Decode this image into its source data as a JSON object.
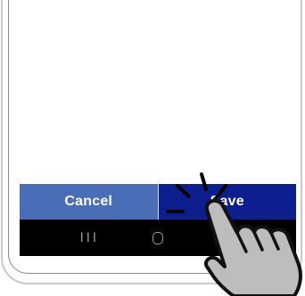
{
  "actions": {
    "cancel_label": "Cancel",
    "save_label": "Save"
  },
  "nav": {
    "recents_icon": "recents-icon",
    "home_icon": "home-icon",
    "back_icon": "back-icon",
    "recents_glyph": "III"
  },
  "overlay": {
    "gesture_icon": "tap-hand-icon"
  },
  "colors": {
    "cancel_bg": "#4a6db8",
    "save_bg": "#0d1f8f",
    "nav_bg": "#000000",
    "hand_fill": "#bdbdbd"
  }
}
